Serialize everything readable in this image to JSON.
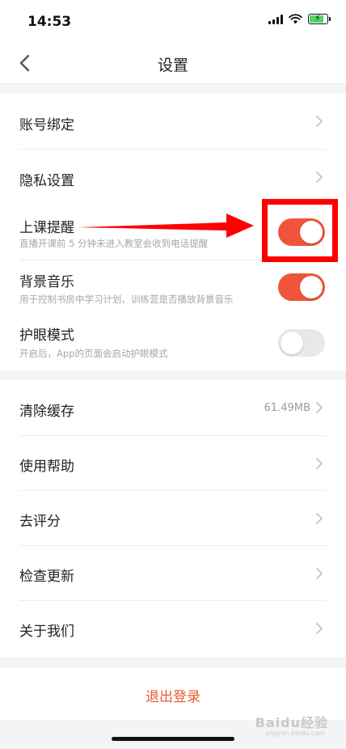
{
  "status_bar": {
    "time": "14:53"
  },
  "nav": {
    "title": "设置"
  },
  "group1": [
    {
      "label": "账号绑定"
    },
    {
      "label": "隐私设置"
    }
  ],
  "toggles": [
    {
      "label": "上课提醒",
      "sub": "直播开课前 5 分钟未进入教室会收到电话提醒",
      "on": true
    },
    {
      "label": "背景音乐",
      "sub": "用于控制书房中学习计划、训练营是否播放背景音乐",
      "on": true
    },
    {
      "label": "护眼模式",
      "sub": "开启后，App的页面会启动护眼模式",
      "on": false
    }
  ],
  "group2": [
    {
      "label": "清除缓存",
      "value": "61.49MB"
    },
    {
      "label": "使用帮助"
    },
    {
      "label": "去评分"
    },
    {
      "label": "检查更新"
    },
    {
      "label": "关于我们"
    }
  ],
  "logout": {
    "label": "退出登录"
  },
  "watermark": {
    "text": "Baidu经验",
    "sub": "jingyan.baidu.com"
  },
  "colors": {
    "accent": "#f0553b",
    "highlight": "#ff0000",
    "logout": "#e85b34"
  }
}
